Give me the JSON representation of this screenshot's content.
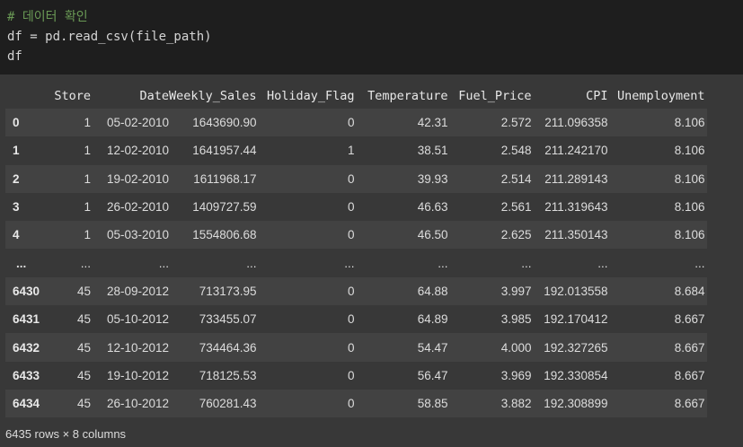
{
  "code": {
    "line1": "# 데이터 확인",
    "line2": "df = pd.read_csv(file_path)",
    "line3": "df"
  },
  "table": {
    "columns": [
      "",
      "Store",
      "Date",
      "Weekly_Sales",
      "Holiday_Flag",
      "Temperature",
      "Fuel_Price",
      "CPI",
      "Unemployment"
    ],
    "rows": [
      [
        "0",
        "1",
        "05-02-2010",
        "1643690.90",
        "0",
        "42.31",
        "2.572",
        "211.096358",
        "8.106"
      ],
      [
        "1",
        "1",
        "12-02-2010",
        "1641957.44",
        "1",
        "38.51",
        "2.548",
        "211.242170",
        "8.106"
      ],
      [
        "2",
        "1",
        "19-02-2010",
        "1611968.17",
        "0",
        "39.93",
        "2.514",
        "211.289143",
        "8.106"
      ],
      [
        "3",
        "1",
        "26-02-2010",
        "1409727.59",
        "0",
        "46.63",
        "2.561",
        "211.319643",
        "8.106"
      ],
      [
        "4",
        "1",
        "05-03-2010",
        "1554806.68",
        "0",
        "46.50",
        "2.625",
        "211.350143",
        "8.106"
      ],
      [
        "...",
        "...",
        "...",
        "...",
        "...",
        "...",
        "...",
        "...",
        "..."
      ],
      [
        "6430",
        "45",
        "28-09-2012",
        "713173.95",
        "0",
        "64.88",
        "3.997",
        "192.013558",
        "8.684"
      ],
      [
        "6431",
        "45",
        "05-10-2012",
        "733455.07",
        "0",
        "64.89",
        "3.985",
        "192.170412",
        "8.667"
      ],
      [
        "6432",
        "45",
        "12-10-2012",
        "734464.36",
        "0",
        "54.47",
        "4.000",
        "192.327265",
        "8.667"
      ],
      [
        "6433",
        "45",
        "19-10-2012",
        "718125.53",
        "0",
        "56.47",
        "3.969",
        "192.330854",
        "8.667"
      ],
      [
        "6434",
        "45",
        "26-10-2012",
        "760281.43",
        "0",
        "58.85",
        "3.882",
        "192.308899",
        "8.667"
      ]
    ]
  },
  "summary": "6435 rows × 8 columns"
}
